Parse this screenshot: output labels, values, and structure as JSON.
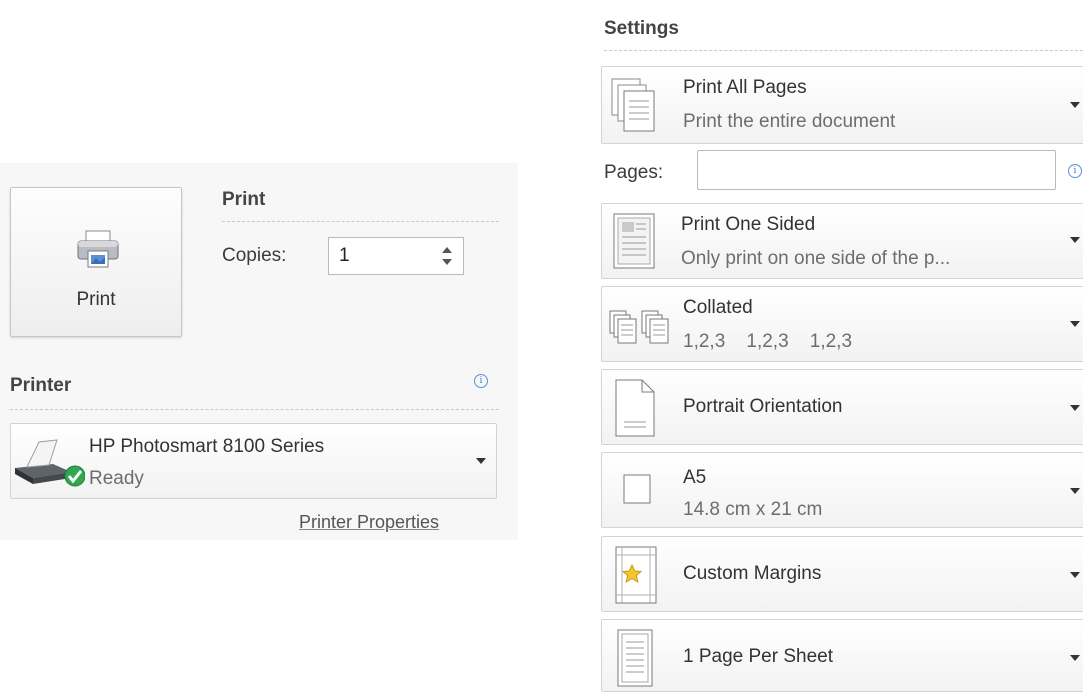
{
  "print_section": {
    "button_label": "Print",
    "title": "Print",
    "copies_label": "Copies:",
    "copies_value": "1"
  },
  "printer_section": {
    "title": "Printer",
    "printer_name": "HP Photosmart 8100 Series",
    "printer_status": "Ready",
    "properties_link": "Printer Properties"
  },
  "settings": {
    "title": "Settings",
    "pages_label": "Pages:",
    "pages_value": "",
    "dropdowns": [
      {
        "main": "Print All Pages",
        "sub": "Print the entire document",
        "icon": "pages-stack-icon"
      },
      {
        "main": "Print One Sided",
        "sub": "Only print on one side of the p...",
        "icon": "one-sided-icon"
      },
      {
        "main": "Collated",
        "sub": "1,2,3    1,2,3    1,2,3",
        "icon": "collated-icon"
      },
      {
        "main": "Portrait Orientation",
        "sub": "",
        "icon": "portrait-icon"
      },
      {
        "main": "A5",
        "sub": "14.8 cm x 21 cm",
        "icon": "paper-size-icon"
      },
      {
        "main": "Custom Margins",
        "sub": "",
        "icon": "margins-icon"
      },
      {
        "main": "1 Page Per Sheet",
        "sub": "",
        "icon": "pages-per-sheet-icon"
      }
    ]
  },
  "colors": {
    "accent": "#3f7bd0",
    "status_ok": "#2fa84f",
    "panel_bg": "#f7f7f7"
  }
}
